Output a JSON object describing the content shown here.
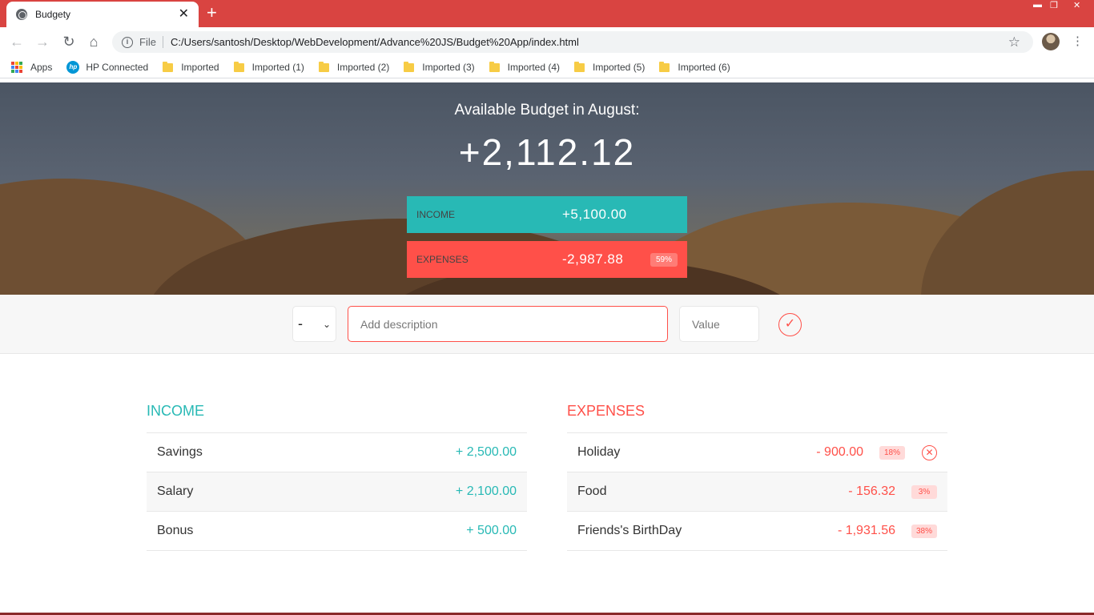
{
  "browser": {
    "tab_title": "Budgety",
    "tab_close": "✕",
    "new_tab": "+",
    "scheme": "File",
    "url": "C:/Users/santosh/Desktop/WebDevelopment/Advance%20JS/Budget%20App/index.html",
    "bookmarks": {
      "apps": "Apps",
      "hp": "HP Connected",
      "folders": [
        "Imported",
        "Imported (1)",
        "Imported (2)",
        "Imported (3)",
        "Imported (4)",
        "Imported (5)",
        "Imported (6)"
      ]
    }
  },
  "top": {
    "title": "Available Budget in August:",
    "budget": "+2,112.12",
    "income_label": "Income",
    "income_value": "+5,100.00",
    "expenses_label": "Expenses",
    "expenses_value": "-2,987.88",
    "expenses_percentage": "59%"
  },
  "add": {
    "type_value": "-",
    "description_placeholder": "Add description",
    "value_placeholder": "Value"
  },
  "income": {
    "title": "Income",
    "items": [
      {
        "description": "Savings",
        "value": "+ 2,500.00"
      },
      {
        "description": "Salary",
        "value": "+ 2,100.00"
      },
      {
        "description": "Bonus",
        "value": "+ 500.00"
      }
    ]
  },
  "expenses": {
    "title": "Expenses",
    "items": [
      {
        "description": "Holiday",
        "value": "- 900.00",
        "percentage": "18%"
      },
      {
        "description": "Food",
        "value": "- 156.32",
        "percentage": "3%"
      },
      {
        "description": "Friends's BirthDay",
        "value": "- 1,931.56",
        "percentage": "38%"
      }
    ]
  },
  "colors": {
    "income": "#28b9b5",
    "expense": "#ff5049",
    "tabbar": "#d94441"
  }
}
